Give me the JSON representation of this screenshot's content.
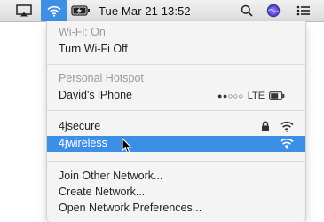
{
  "menubar": {
    "icons": [
      "airplay-icon",
      "wifi-icon",
      "battery-charging-icon",
      "search-icon",
      "siri-icon",
      "notification-list-icon"
    ],
    "clock": "Tue Mar 21  13:52"
  },
  "menu": {
    "wifi_status": "Wi-Fi: On",
    "wifi_toggle": "Turn Wi-Fi Off",
    "hotspot_header": "Personal Hotspot",
    "hotspot_device": "David's iPhone",
    "hotspot_signal": "●●○○○",
    "hotspot_network_type": "LTE",
    "networks": [
      {
        "name": "4jsecure",
        "locked": true,
        "selected": false
      },
      {
        "name": "4jwireless",
        "locked": false,
        "selected": true
      }
    ],
    "actions": {
      "join_other": "Join Other Network...",
      "create": "Create Network...",
      "preferences": "Open Network Preferences..."
    }
  },
  "colors": {
    "selection": "#3d8fe6",
    "muted_text": "#9a9a9a"
  }
}
